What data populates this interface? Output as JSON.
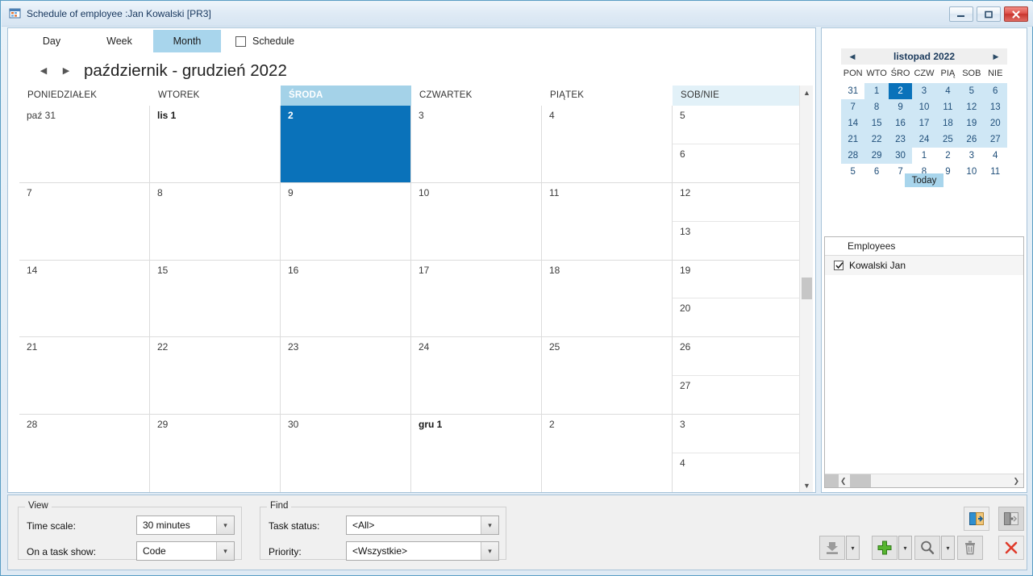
{
  "window": {
    "title": "Schedule of employee :Jan Kowalski [PR3]",
    "icon": "grid-app-icon",
    "buttons": {
      "minimize": "minimize-icon",
      "maximize": "maximize-icon",
      "close": "close-icon"
    }
  },
  "tabs": [
    {
      "label": "Day",
      "active": false
    },
    {
      "label": "Week",
      "active": false
    },
    {
      "label": "Month",
      "active": true
    }
  ],
  "schedule_checkbox": {
    "label": "Schedule",
    "checked": false
  },
  "navigation": {
    "prev": "◀",
    "next": "▶",
    "range_title": "październik - grudzień 2022"
  },
  "calendar": {
    "day_headers": [
      {
        "label": "PONIEDZIAŁEK",
        "state": "normal"
      },
      {
        "label": "WTOREK",
        "state": "normal"
      },
      {
        "label": "ŚRODA",
        "state": "selected"
      },
      {
        "label": "CZWARTEK",
        "state": "normal"
      },
      {
        "label": "PIĄTEK",
        "state": "normal"
      },
      {
        "label": "SOB/NIE",
        "state": "weekend"
      }
    ],
    "weeks": [
      {
        "cells": [
          {
            "label": "paź 31",
            "bold": false,
            "selected": false
          },
          {
            "label": "lis 1",
            "bold": true,
            "selected": false
          },
          {
            "label": "2",
            "bold": true,
            "selected": true
          },
          {
            "label": "3",
            "bold": false,
            "selected": false
          },
          {
            "label": "4",
            "bold": false,
            "selected": false
          },
          {
            "label": "5",
            "bold": false,
            "selected": false,
            "label2": "6"
          }
        ]
      },
      {
        "cells": [
          {
            "label": "7",
            "bold": false,
            "selected": false
          },
          {
            "label": "8",
            "bold": false,
            "selected": false
          },
          {
            "label": "9",
            "bold": false,
            "selected": false
          },
          {
            "label": "10",
            "bold": false,
            "selected": false
          },
          {
            "label": "11",
            "bold": false,
            "selected": false
          },
          {
            "label": "12",
            "bold": false,
            "selected": false,
            "label2": "13"
          }
        ]
      },
      {
        "cells": [
          {
            "label": "14",
            "bold": false,
            "selected": false
          },
          {
            "label": "15",
            "bold": false,
            "selected": false
          },
          {
            "label": "16",
            "bold": false,
            "selected": false
          },
          {
            "label": "17",
            "bold": false,
            "selected": false
          },
          {
            "label": "18",
            "bold": false,
            "selected": false
          },
          {
            "label": "19",
            "bold": false,
            "selected": false,
            "label2": "20"
          }
        ]
      },
      {
        "cells": [
          {
            "label": "21",
            "bold": false,
            "selected": false
          },
          {
            "label": "22",
            "bold": false,
            "selected": false
          },
          {
            "label": "23",
            "bold": false,
            "selected": false
          },
          {
            "label": "24",
            "bold": false,
            "selected": false
          },
          {
            "label": "25",
            "bold": false,
            "selected": false
          },
          {
            "label": "26",
            "bold": false,
            "selected": false,
            "label2": "27"
          }
        ]
      },
      {
        "cells": [
          {
            "label": "28",
            "bold": false,
            "selected": false
          },
          {
            "label": "29",
            "bold": false,
            "selected": false
          },
          {
            "label": "30",
            "bold": false,
            "selected": false
          },
          {
            "label": "gru 1",
            "bold": true,
            "selected": false
          },
          {
            "label": "2",
            "bold": false,
            "selected": false
          },
          {
            "label": "3",
            "bold": false,
            "selected": false,
            "label2": "4"
          }
        ]
      }
    ]
  },
  "minicalendar": {
    "title": "listopad 2022",
    "prev": "◀",
    "next": "▶",
    "dow": [
      "PON",
      "WTO",
      "ŚRO",
      "CZW",
      "PIĄ",
      "SOB",
      "NIE"
    ],
    "rows": [
      [
        {
          "d": "31",
          "cls": "other"
        },
        {
          "d": "1",
          "cls": "inmonth"
        },
        {
          "d": "2",
          "cls": "today"
        },
        {
          "d": "3",
          "cls": "inmonth"
        },
        {
          "d": "4",
          "cls": "inmonth"
        },
        {
          "d": "5",
          "cls": "inmonth"
        },
        {
          "d": "6",
          "cls": "inmonth"
        }
      ],
      [
        {
          "d": "7",
          "cls": "inmonth"
        },
        {
          "d": "8",
          "cls": "inmonth"
        },
        {
          "d": "9",
          "cls": "inmonth"
        },
        {
          "d": "10",
          "cls": "inmonth"
        },
        {
          "d": "11",
          "cls": "inmonth"
        },
        {
          "d": "12",
          "cls": "inmonth"
        },
        {
          "d": "13",
          "cls": "inmonth"
        }
      ],
      [
        {
          "d": "14",
          "cls": "inmonth"
        },
        {
          "d": "15",
          "cls": "inmonth"
        },
        {
          "d": "16",
          "cls": "inmonth"
        },
        {
          "d": "17",
          "cls": "inmonth"
        },
        {
          "d": "18",
          "cls": "inmonth"
        },
        {
          "d": "19",
          "cls": "inmonth"
        },
        {
          "d": "20",
          "cls": "inmonth"
        }
      ],
      [
        {
          "d": "21",
          "cls": "inmonth"
        },
        {
          "d": "22",
          "cls": "inmonth"
        },
        {
          "d": "23",
          "cls": "inmonth"
        },
        {
          "d": "24",
          "cls": "inmonth"
        },
        {
          "d": "25",
          "cls": "inmonth"
        },
        {
          "d": "26",
          "cls": "inmonth"
        },
        {
          "d": "27",
          "cls": "inmonth"
        }
      ],
      [
        {
          "d": "28",
          "cls": "inmonth"
        },
        {
          "d": "29",
          "cls": "inmonth"
        },
        {
          "d": "30",
          "cls": "inmonth"
        },
        {
          "d": "1",
          "cls": "other"
        },
        {
          "d": "2",
          "cls": "other"
        },
        {
          "d": "3",
          "cls": "other"
        },
        {
          "d": "4",
          "cls": "other"
        }
      ],
      [
        {
          "d": "5",
          "cls": "other"
        },
        {
          "d": "6",
          "cls": "other"
        },
        {
          "d": "7",
          "cls": "other"
        },
        {
          "d": "8",
          "cls": "other"
        },
        {
          "d": "9",
          "cls": "other"
        },
        {
          "d": "10",
          "cls": "other"
        },
        {
          "d": "11",
          "cls": "other"
        }
      ]
    ],
    "today_button": "Today"
  },
  "employees": {
    "header": "Employees",
    "items": [
      {
        "name": "Kowalski Jan",
        "checked": true
      }
    ]
  },
  "view_group": {
    "legend": "View",
    "time_scale_label": "Time scale:",
    "time_scale_value": "30 minutes",
    "on_task_show_label": "On a task show:",
    "on_task_show_value": "Code"
  },
  "find_group": {
    "legend": "Find",
    "task_status_label": "Task status:",
    "task_status_value": "<All>",
    "priority_label": "Priority:",
    "priority_value": "<Wszystkie>"
  },
  "colors": {
    "accent_blue": "#0a72ba",
    "tab_active": "#a8d5ec",
    "header_selected": "#a4d2e8",
    "weekend_header": "#e2f1f8",
    "minical_month": "#cfe7f5",
    "close_red": "#c8352e"
  }
}
